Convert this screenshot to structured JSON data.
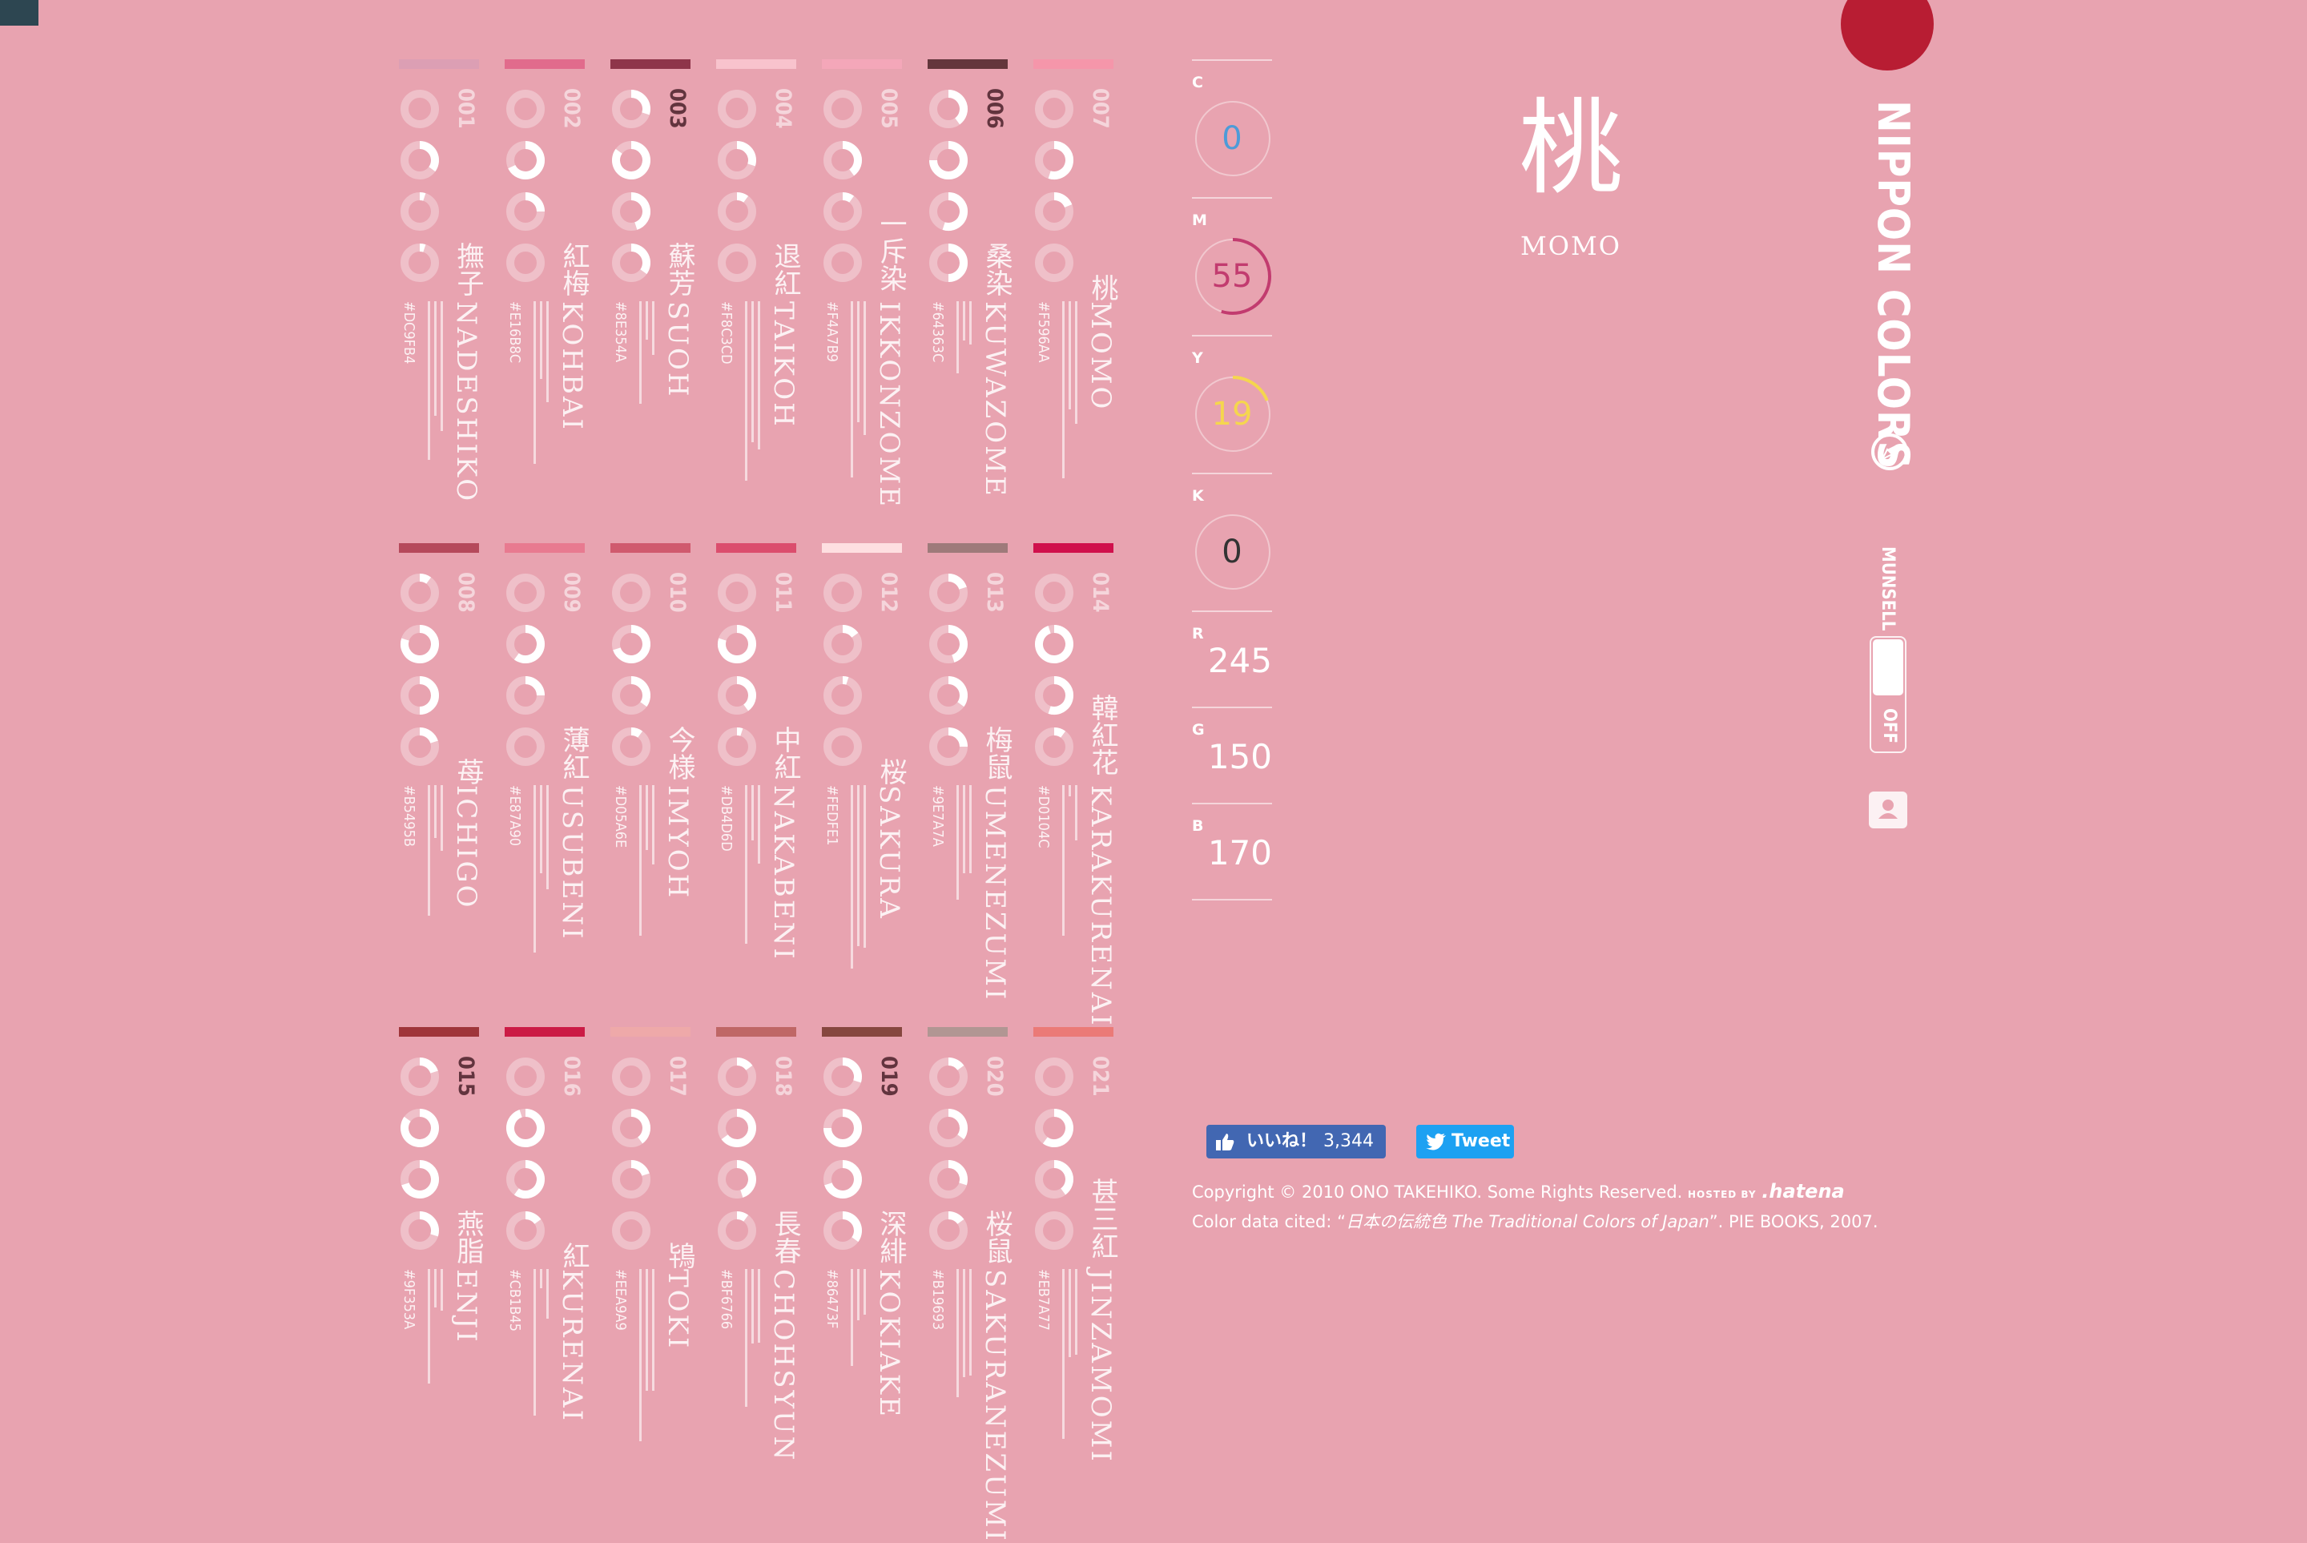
{
  "selected": {
    "kanji": "桃",
    "romaji": "MOMO"
  },
  "values": {
    "C": 0,
    "M": 55,
    "Y": 19,
    "K": 0,
    "R": 245,
    "G": 150,
    "B": 170
  },
  "labels": {
    "C": "C",
    "M": "M",
    "Y": "Y",
    "K": "K",
    "R": "R",
    "G": "G",
    "B": "B"
  },
  "nav": {
    "brand": "NIPPON COLORS",
    "munsell": "MUNSELL",
    "toggle_state": "OFF"
  },
  "social": {
    "like_label": "いいね！",
    "like_count": "3,344",
    "tweet_label": "Tweet"
  },
  "footer": {
    "copyright": "Copyright © 2010 ONO TAKEHIKO. Some Rights Reserved.",
    "hosted_by": "HOSTED BY",
    "host": ".hatena",
    "cited_prefix": "Color data cited: “",
    "cited_title": "日本の伝統色 The Traditional Colors of Japan",
    "cited_suffix": "”. PIE BOOKS, 2007."
  },
  "colors": [
    {
      "num": "001",
      "kanji": "撫子",
      "romaji": "NADESHIKO",
      "hex": "#DC9FB4",
      "cmyk": [
        0,
        35,
        5,
        5
      ],
      "dark": false
    },
    {
      "num": "002",
      "kanji": "紅梅",
      "romaji": "KOHBAI",
      "hex": "#E16B8C",
      "cmyk": [
        0,
        68,
        25,
        0
      ],
      "dark": false
    },
    {
      "num": "003",
      "kanji": "蘇芳",
      "romaji": "SUOH",
      "hex": "#8E354A",
      "cmyk": [
        30,
        85,
        45,
        35
      ],
      "dark": true
    },
    {
      "num": "004",
      "kanji": "退紅",
      "romaji": "TAIKOH",
      "hex": "#F8C3CD",
      "cmyk": [
        0,
        30,
        10,
        0
      ],
      "dark": false
    },
    {
      "num": "005",
      "kanji": "一斥染",
      "romaji": "IKKONZOME",
      "hex": "#F4A7B9",
      "cmyk": [
        0,
        40,
        10,
        0
      ],
      "dark": false
    },
    {
      "num": "006",
      "kanji": "桑染",
      "romaji": "KUWAZOME",
      "hex": "#64363C",
      "cmyk": [
        40,
        75,
        55,
        50
      ],
      "dark": true
    },
    {
      "num": "007",
      "kanji": "桃",
      "romaji": "MOMO",
      "hex": "#F596AA",
      "cmyk": [
        0,
        55,
        19,
        0
      ],
      "dark": false
    },
    {
      "num": "008",
      "kanji": "苺",
      "romaji": "ICHIGO",
      "hex": "#B5495B",
      "cmyk": [
        10,
        80,
        50,
        20
      ],
      "dark": false
    },
    {
      "num": "009",
      "kanji": "薄紅",
      "romaji": "USUBENI",
      "hex": "#E87A90",
      "cmyk": [
        0,
        60,
        25,
        0
      ],
      "dark": false
    },
    {
      "num": "010",
      "kanji": "今様",
      "romaji": "IMYOH",
      "hex": "#D05A6E",
      "cmyk": [
        0,
        70,
        35,
        10
      ],
      "dark": false
    },
    {
      "num": "011",
      "kanji": "中紅",
      "romaji": "NAKABENI",
      "hex": "#DB4D6D",
      "cmyk": [
        0,
        80,
        40,
        5
      ],
      "dark": false
    },
    {
      "num": "012",
      "kanji": "桜",
      "romaji": "SAKURA",
      "hex": "#FEDFE1",
      "cmyk": [
        0,
        15,
        5,
        0
      ],
      "dark": false
    },
    {
      "num": "013",
      "kanji": "梅鼠",
      "romaji": "UMENEZUMI",
      "hex": "#9E7A7A",
      "cmyk": [
        20,
        45,
        35,
        25
      ],
      "dark": false
    },
    {
      "num": "014",
      "kanji": "韓紅花",
      "romaji": "KARAKURENAI",
      "hex": "#D0104C",
      "cmyk": [
        0,
        95,
        55,
        10
      ],
      "dark": false
    },
    {
      "num": "015",
      "kanji": "燕脂",
      "romaji": "ENJI",
      "hex": "#9F353A",
      "cmyk": [
        20,
        85,
        70,
        30
      ],
      "dark": true
    },
    {
      "num": "016",
      "kanji": "紅",
      "romaji": "KURENAI",
      "hex": "#CB1B45",
      "cmyk": [
        0,
        95,
        60,
        15
      ],
      "dark": false
    },
    {
      "num": "017",
      "kanji": "鴇",
      "romaji": "TOKI",
      "hex": "#EEA9A9",
      "cmyk": [
        0,
        40,
        20,
        0
      ],
      "dark": false
    },
    {
      "num": "018",
      "kanji": "長春",
      "romaji": "CHOHSYUN",
      "hex": "#BF6766",
      "cmyk": [
        15,
        65,
        45,
        10
      ],
      "dark": false
    },
    {
      "num": "019",
      "kanji": "深緋",
      "romaji": "KOKIAKE",
      "hex": "#86473F",
      "cmyk": [
        30,
        75,
        70,
        35
      ],
      "dark": true
    },
    {
      "num": "020",
      "kanji": "桜鼠",
      "romaji": "SAKURANEZUMI",
      "hex": "#B19693",
      "cmyk": [
        15,
        35,
        30,
        15
      ],
      "dark": false
    },
    {
      "num": "021",
      "kanji": "甚三紅",
      "romaji": "JINZAMOMI",
      "hex": "#EB7A77",
      "cmyk": [
        0,
        60,
        40,
        0
      ],
      "dark": false
    }
  ]
}
